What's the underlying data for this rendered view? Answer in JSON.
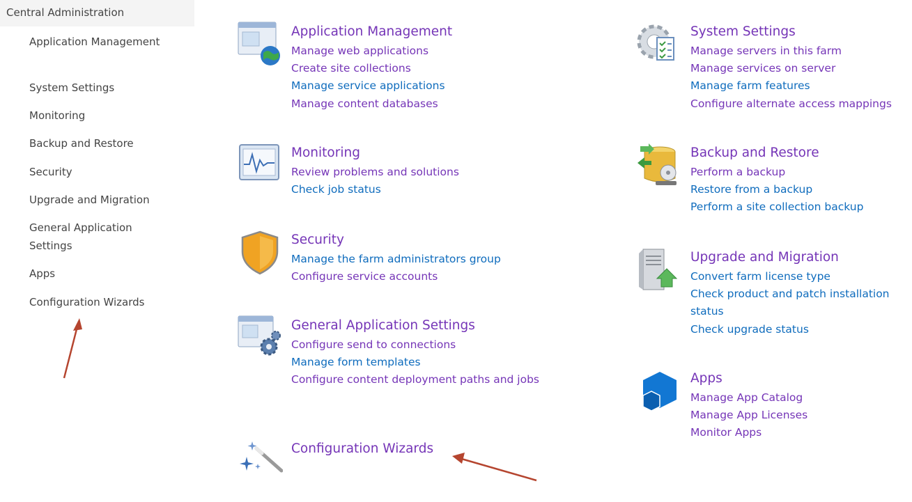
{
  "sidebar": {
    "header": "Central Administration",
    "items": [
      {
        "label": "Application Management"
      },
      {
        "label": "System Settings"
      },
      {
        "label": "Monitoring"
      },
      {
        "label": "Backup and Restore"
      },
      {
        "label": "Security"
      },
      {
        "label": "Upgrade and Migration"
      },
      {
        "label": "General Application Settings"
      },
      {
        "label": "Apps"
      },
      {
        "label": "Configuration Wizards"
      }
    ]
  },
  "sections": {
    "app_management": {
      "title": "Application Management",
      "icon": "application-management-icon",
      "links": [
        "Manage web applications",
        "Create site collections",
        "Manage service applications",
        "Manage content databases"
      ]
    },
    "monitoring": {
      "title": "Monitoring",
      "icon": "monitoring-icon",
      "links": [
        "Review problems and solutions",
        "Check job status"
      ]
    },
    "security": {
      "title": "Security",
      "icon": "shield-icon",
      "links": [
        "Manage the farm administrators group",
        "Configure service accounts"
      ]
    },
    "general_settings": {
      "title": "General Application Settings",
      "icon": "general-settings-icon",
      "links": [
        "Configure send to connections",
        "Manage form templates",
        "Configure content deployment paths and jobs"
      ]
    },
    "config_wizards": {
      "title": "Configuration Wizards",
      "icon": "magic-wand-icon"
    },
    "system_settings": {
      "title": "System Settings",
      "icon": "system-settings-icon",
      "links": [
        "Manage servers in this farm",
        "Manage services on server",
        "Manage farm features",
        "Configure alternate access mappings"
      ]
    },
    "backup_restore": {
      "title": "Backup and Restore",
      "icon": "backup-restore-icon",
      "links": [
        "Perform a backup",
        "Restore from a backup",
        "Perform a site collection backup"
      ]
    },
    "upgrade_migration": {
      "title": "Upgrade and Migration",
      "icon": "upgrade-server-icon",
      "links": [
        "Convert farm license type",
        "Check product and patch installation status",
        "Check upgrade status"
      ]
    },
    "apps": {
      "title": "Apps",
      "icon": "apps-cube-icon",
      "links": [
        "Manage App Catalog",
        "Manage App Licenses",
        "Monitor Apps"
      ]
    }
  },
  "colors": {
    "link_visited": "#7535b7",
    "link_unvisited": "#0f6cbd",
    "nav_text": "#444444",
    "annotation_arrow": "#b5452f"
  }
}
